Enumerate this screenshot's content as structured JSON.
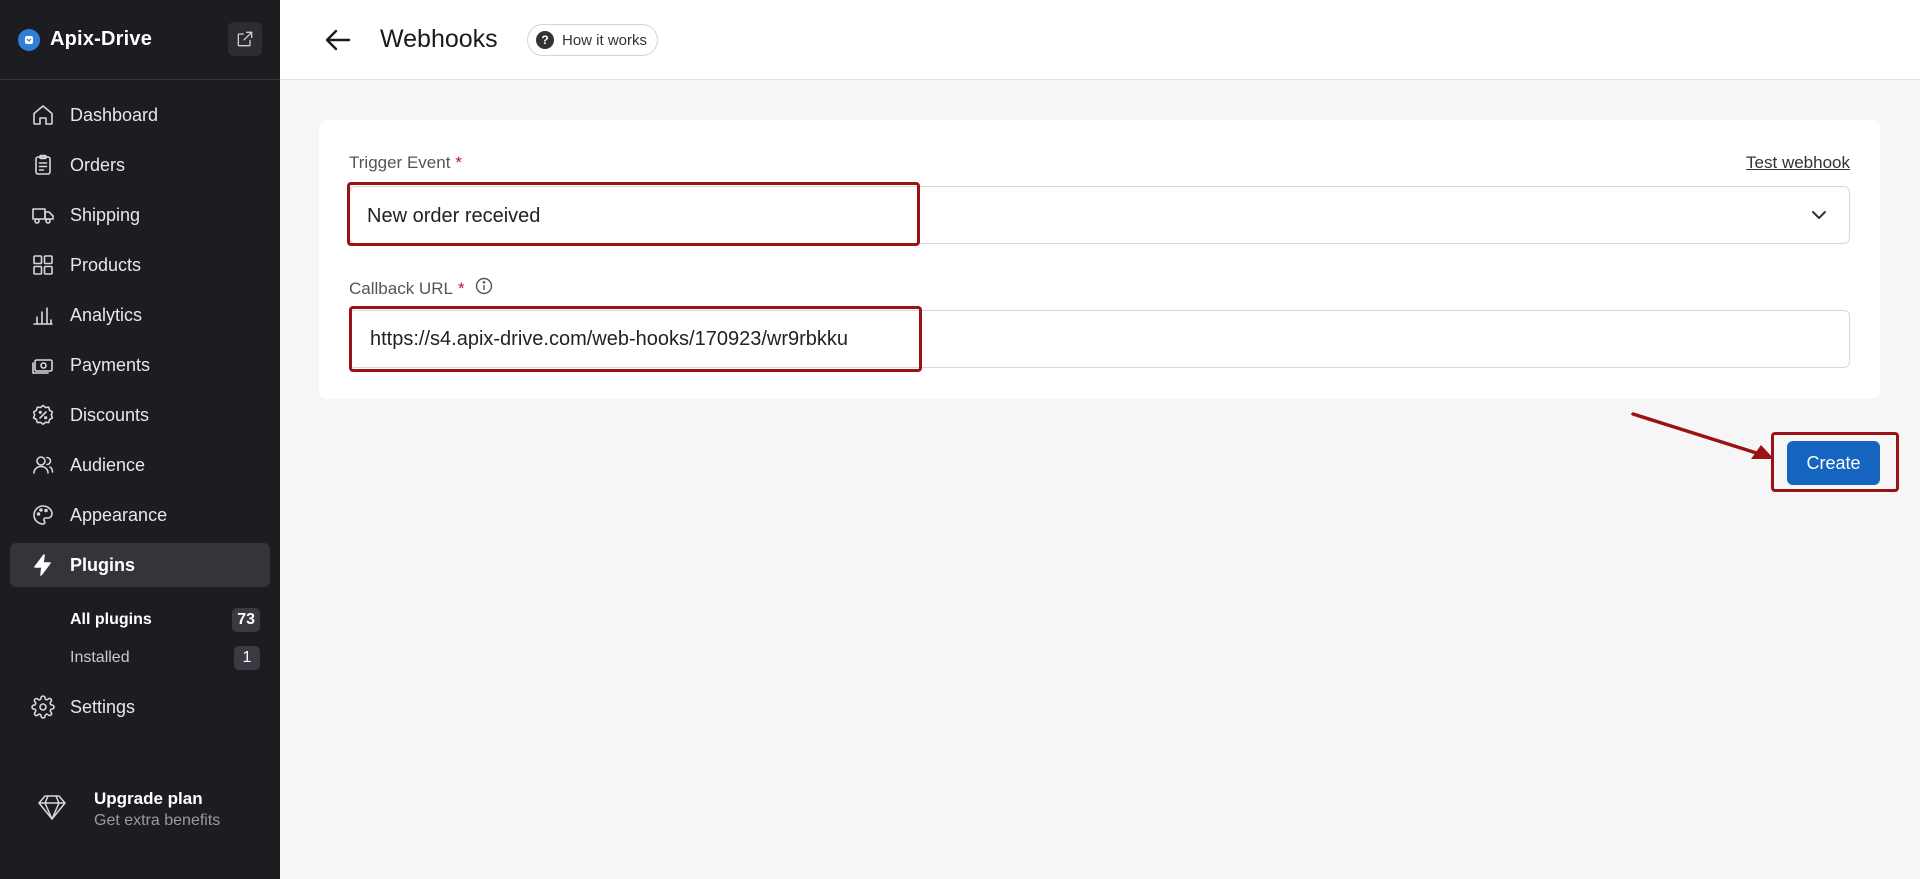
{
  "sidebar": {
    "brand": "Apix-Drive",
    "nav": [
      {
        "label": "Dashboard",
        "icon": "home-icon"
      },
      {
        "label": "Orders",
        "icon": "clipboard-icon"
      },
      {
        "label": "Shipping",
        "icon": "truck-icon"
      },
      {
        "label": "Products",
        "icon": "grid-icon"
      },
      {
        "label": "Analytics",
        "icon": "bar-chart-icon"
      },
      {
        "label": "Payments",
        "icon": "cash-icon"
      },
      {
        "label": "Discounts",
        "icon": "percent-badge-icon"
      },
      {
        "label": "Audience",
        "icon": "users-icon"
      },
      {
        "label": "Appearance",
        "icon": "palette-icon"
      },
      {
        "label": "Plugins",
        "icon": "lightning-icon",
        "active": true
      }
    ],
    "sub": {
      "all_plugins": {
        "label": "All plugins",
        "count": "73"
      },
      "installed": {
        "label": "Installed",
        "count": "1"
      }
    },
    "settings": {
      "label": "Settings",
      "icon": "gear-icon"
    },
    "upgrade": {
      "title": "Upgrade plan",
      "subtitle": "Get extra benefits"
    }
  },
  "header": {
    "title": "Webhooks",
    "how_it_works": "How it works"
  },
  "form": {
    "trigger_label": "Trigger Event",
    "required_mark": "*",
    "test_webhook": "Test webhook",
    "trigger_value": "New order received",
    "callback_label": "Callback URL",
    "callback_value": "https://s4.apix-drive.com/web-hooks/170923/wr9rbkku"
  },
  "actions": {
    "create": "Create"
  },
  "colors": {
    "sidebar_bg": "#1c1c21",
    "accent": "#1565c0",
    "highlight": "#9b1215",
    "required": "#c8102e"
  }
}
